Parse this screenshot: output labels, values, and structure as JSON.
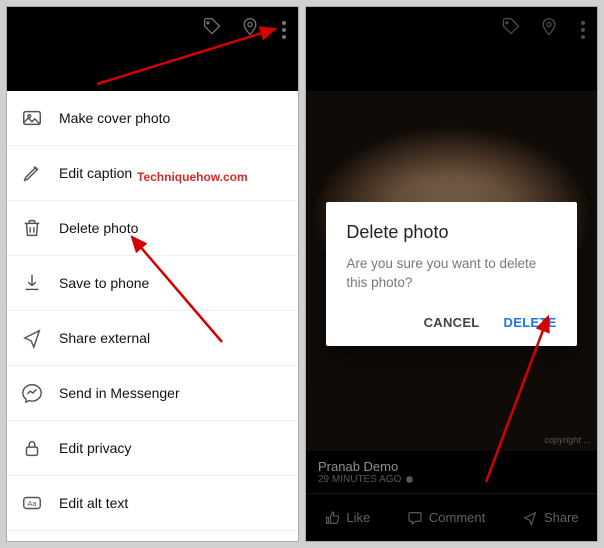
{
  "topbar": {
    "tag_icon": "tag-icon",
    "location_icon": "location-icon",
    "more_icon": "more-vertical-icon"
  },
  "menu": {
    "items": [
      {
        "label": "Make cover photo",
        "icon": "image-icon"
      },
      {
        "label": "Edit caption",
        "icon": "pencil-icon"
      },
      {
        "label": "Delete photo",
        "icon": "trash-icon"
      },
      {
        "label": "Save to phone",
        "icon": "download-icon"
      },
      {
        "label": "Share external",
        "icon": "share-icon"
      },
      {
        "label": "Send in Messenger",
        "icon": "messenger-icon"
      },
      {
        "label": "Edit privacy",
        "icon": "lock-icon"
      },
      {
        "label": "Edit alt text",
        "icon": "alt-text-icon"
      }
    ]
  },
  "watermark": "Techniquehow.com",
  "dialog": {
    "title": "Delete photo",
    "message": "Are you sure you want to delete this photo?",
    "cancel": "CANCEL",
    "confirm": "DELETE"
  },
  "post": {
    "author": "Pranab Demo",
    "time": "29 MINUTES AGO",
    "copyright": "copyright ..."
  },
  "actions": {
    "like": "Like",
    "comment": "Comment",
    "share": "Share"
  }
}
